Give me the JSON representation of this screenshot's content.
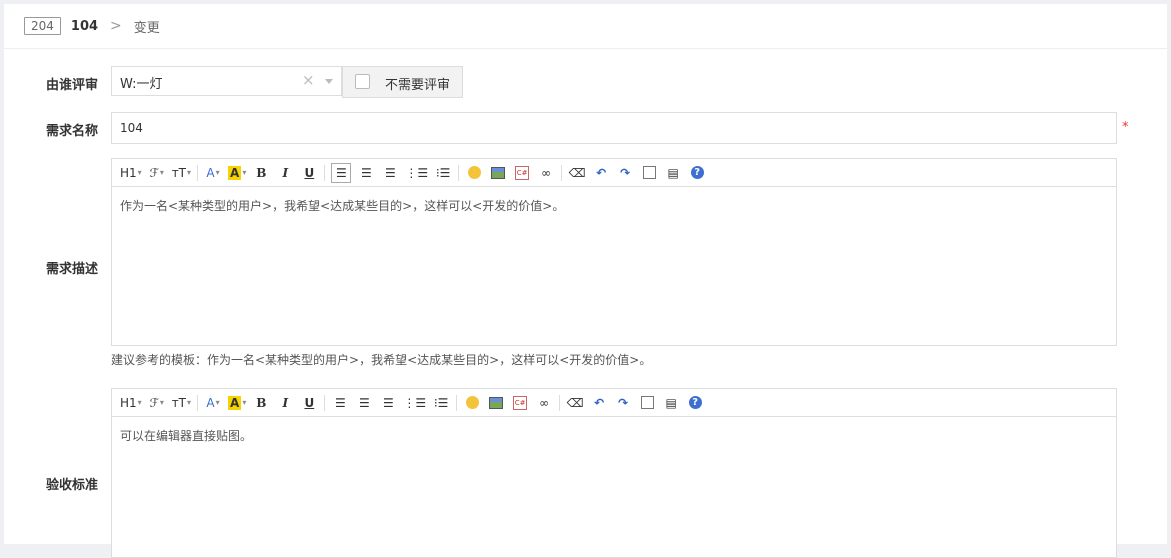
{
  "breadcrumb": {
    "id": "204",
    "title": "104",
    "separator": ">",
    "action": "变更"
  },
  "reviewer": {
    "label": "由谁评审",
    "value": "W:一灯",
    "clear": "×",
    "no_review_label": "不需要评审"
  },
  "story_name": {
    "label": "需求名称",
    "value": "104",
    "required_mark": "*"
  },
  "toolbar": {
    "heading": "H1",
    "font": "ℱ",
    "size": "ᴛT",
    "font_color": "A",
    "bg_color": "A",
    "bold": "B",
    "italic": "I",
    "underline": "U",
    "help": "?"
  },
  "description": {
    "label": "需求描述",
    "content": "作为一名<某种类型的用户>，我希望<达成某些目的>，这样可以<开发的价值>。",
    "hint": "建议参考的模板：作为一名<某种类型的用户>，我希望<达成某些目的>，这样可以<开发的价值>。"
  },
  "acceptance": {
    "label": "验收标准",
    "content": "可以在编辑器直接贴图。"
  }
}
